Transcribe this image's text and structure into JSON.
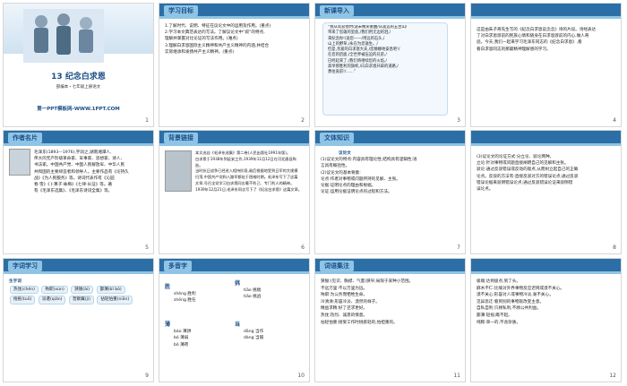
{
  "slides": [
    {
      "num": "1",
      "title": "13 纪念白求恩",
      "subtitle": "部编本・七年级上册语文",
      "url": "第一PPT模板网-WWW.1PPT.COM"
    },
    {
      "num": "2",
      "heading": "学习目标",
      "lines": [
        "1.了解时代、说明、特征在议论文中的运用及作用。(重点)",
        "2.学习本文典范表达的写法。了解议论文中“叙”的特点,",
        "理解并掌握对比论证的写法作用。(难点)",
        "3.理解白求恩国际主义精神和共产主义精神的内涵,并结合",
        "实际继承和发扬共产主义精神。(重点)"
      ]
    },
    {
      "num": "3",
      "heading": "新课导入",
      "lines": [
        "“我从欢迎他时/送未晚荣重曲/从遥远的五台山/",
        "带来了您雄的里底,/我们用无边的泪,/",
        "来纪念你!/送您——/用远的石头,/",
        "山上的野草,/永在为您滋生。/",
        "但是,亲爱的白求恩大夫,/您静静地安息吧!/",
        "在您的后面,/全世界被压迫的兄弟,/",
        "已经起来了,/我们将继续您的火焰,/",
        "高举那胜利的旗帜,/向白求恩开辟的道路,/",
        "勇往直前!/……”"
      ]
    },
    {
      "num": "4",
      "lines": [
        "这是由朱子奇先生写的《纪念白求恩说念念》诗的片段。诗经表达",
        "了对白求恩渡前的民族心情和随身在白求恩渡前的内心,做人奇",
        "迹。今天,我们一起来学习毛泽东同志的《纪念白求恩》,看",
        "看白求恩同志的那最精神理解感的学习。"
      ]
    },
    {
      "num": "5",
      "heading": "作者名片",
      "lines": [
        "毛泽东(1893—1976),字润之,湖南湘潭人,",
        "伟大的无产阶级革命家、军事家、思想家、诗人、",
        "书法家。中国共产党、中国人民解放军、中华人民",
        "共和国的主要缔造者和领导人。主要作品有《论持久",
        "战》《为人民服务》等。诗词代表作有《沁园",
        "春·雪》《卜算子·咏梅》《七律·长征》等。著",
        "有《毛泽东选集》、《毛泽东诗词全集》等。"
      ]
    },
    {
      "num": "6",
      "heading": "背景链接",
      "lines": [
        "本文选自《毛泽东选集》第二卷(人民出版社1991年版)。",
        "白求恩于1938年到延安工作,1939年11月12日在河北唐县殉逝。",
        "当时抗日战争已经进入相持阶段,敌后根据地受到日军的大规模",
        "扫荡,中国共产党和八路军都处于困难时期。毛泽东写下了这篇",
        "文章,号召全党学习白求恩同志毫不利己、专门利人的精神。",
        "1939年12月21日,毛泽东同志写下了《纪念白求恩》这篇文章。"
      ]
    },
    {
      "num": "7",
      "heading": "文体知识",
      "sub": "议论文",
      "lines": [
        "(1)议论文的特点:内容具有理论性;结构具有逻辑性;语",
        "言具有概括性。",
        "(2)议论文的基本要素:",
        "论点:作者对事物或问题所持的见解、主张。",
        "论据:证明论点的理由和根据。",
        "论证:运用论据证明论点的过程和方法。"
      ]
    },
    {
      "num": "8",
      "lines": [
        "(3)议论文的论证方式:分立论、驳论两种。",
        "立论:针对事物或问题直接阐明自己的见解和主张。",
        "驳论:通过反驳错误或反动的观点,从而树立起自己的正确",
        "论点。反驳的方法有:直接反驳对方的错误论点;通过反驳",
        "错误论据来驳倒错误论点;通过反驳错误论证来驳倒错",
        "误论点。"
      ]
    },
    {
      "num": "9",
      "heading": "字词学习",
      "sub": "生字词",
      "items": [
        "热忱(chén)",
        "殉职(xùn)",
        "狭隘(ài)",
        "鄙薄(bǐ bó)",
        "拖拖(tuō)",
        "派遣(qiǎn)",
        "晋察冀(jì)",
        "拈轻怕重(niān)"
      ]
    },
    {
      "num": "10",
      "heading": "多音字",
      "groups": [
        {
          "char": "胜",
          "readings": [
            "shèng 胜利",
            "shēng 胜任"
          ]
        },
        {
          "char": "挑",
          "readings": [
            "tiāo 挑剔",
            "tiǎo 挑战"
          ]
        },
        {
          "char": "薄",
          "readings": [
            "báo 薄饼",
            "bó 薄弱",
            "bò 薄荷"
          ]
        },
        {
          "char": "当",
          "readings": [
            "dāng 当作",
            "dàng 当铺"
          ]
        }
      ]
    },
    {
      "num": "11",
      "heading": "词语集注",
      "lines": [
        "狭隘:(见识、胸襟、气量)狭窄;局限于某种小范围。",
        "不远万里:不以万里为远。",
        "殉职:为公务而牺牲生命。",
        "冷清清:形容冷淡、漠然的样子。",
        "精益求精:好了还求更好。",
        "热忱:热烈、诚恳的情意。",
        "拈轻怕重:接受工作时挑拣轻的,怕担重的。"
      ]
    },
    {
      "num": "12",
      "lines": [
        "极端:达到极点,到了头。",
        "麻木不仁:比喻对外界事物反应迟钝或漠不关心。",
        "漠不关心:形容对人或事物冷淡,毫不关心。",
        "见异思迁:看到别的事物就改变主意。",
        "自私自利:只顾私利,不顾公共利益。",
        "鄙薄:轻视,瞧不起。",
        "纯粹:单一的,不含杂质。"
      ]
    }
  ]
}
